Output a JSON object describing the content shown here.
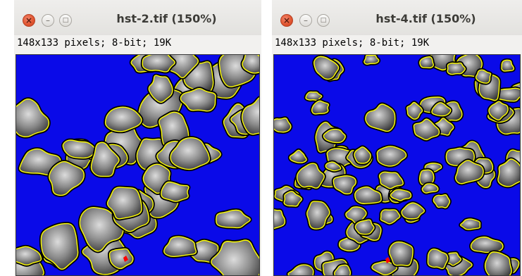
{
  "windows": [
    {
      "title": "hst-2.tif (150%)",
      "info": "148x133 pixels; 8-bit; 19K"
    },
    {
      "title": "hst-4.tif (150%)",
      "info": "148x133 pixels; 8-bit; 19K"
    }
  ],
  "icons": {
    "close": "×",
    "minimize": "–",
    "maximize": "□"
  },
  "colors": {
    "background": "#0a0ae8",
    "outline": "#ffff00",
    "highlight": "#ff0000"
  }
}
